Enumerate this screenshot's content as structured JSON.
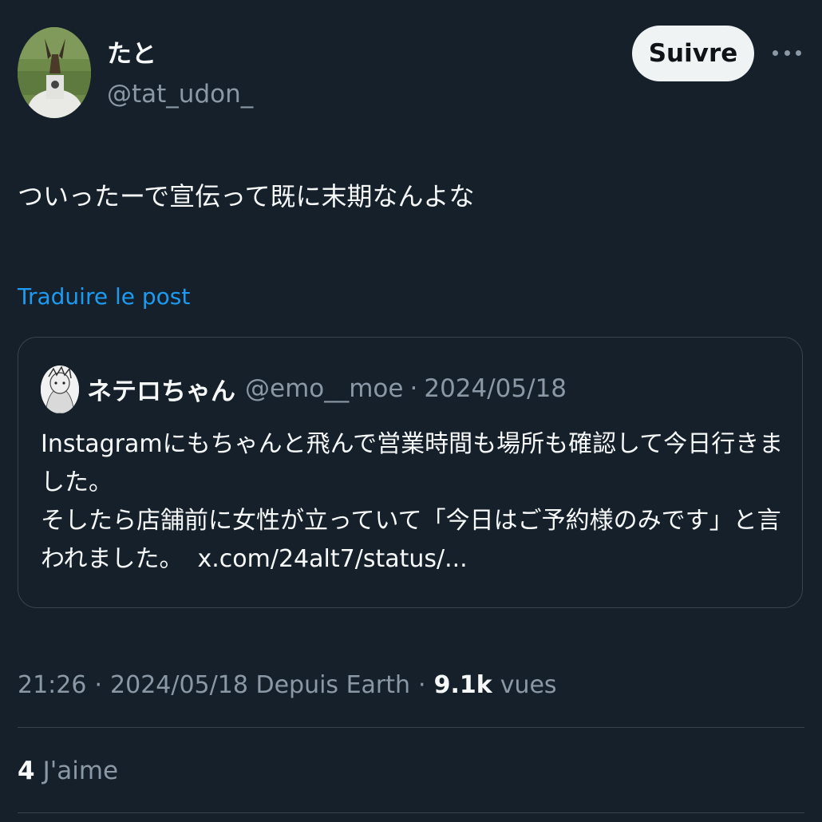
{
  "author": {
    "display_name": "たと",
    "handle": "@tat_udon_",
    "avatar_icon": "user-avatar-icon"
  },
  "actions": {
    "follow_label": "Suivre",
    "more_icon": "more-horizontal-icon"
  },
  "post": {
    "text": "ついったーで宣伝って既に末期なんよな",
    "translate_label": "Traduire le post"
  },
  "quote": {
    "display_name": "ネテロちゃん",
    "handle": "@emo__moe",
    "separator": "·",
    "date": "2024/05/18",
    "lines": [
      "Instagramにもちゃんと飛んで営業時間も場所も確認して今日行きま",
      "した。",
      "そしたら店舗前に女性が立っていて「今日はご予約様のみです」と言",
      "われました。"
    ],
    "link": "x.com/24alt7/status/..."
  },
  "meta": {
    "time": "21:26",
    "separator": "·",
    "date_source": "2024/05/18 Depuis Earth",
    "views_count": "9.1k",
    "views_label": "vues"
  },
  "stats": {
    "likes_count": "4",
    "likes_label": "J'aime"
  },
  "colors": {
    "background": "#15202b",
    "primary_text": "#f7f9f9",
    "secondary_text": "#8b98a5",
    "link": "#1d9bf0",
    "border": "#38444d",
    "follow_button_bg": "#eff3f4"
  }
}
